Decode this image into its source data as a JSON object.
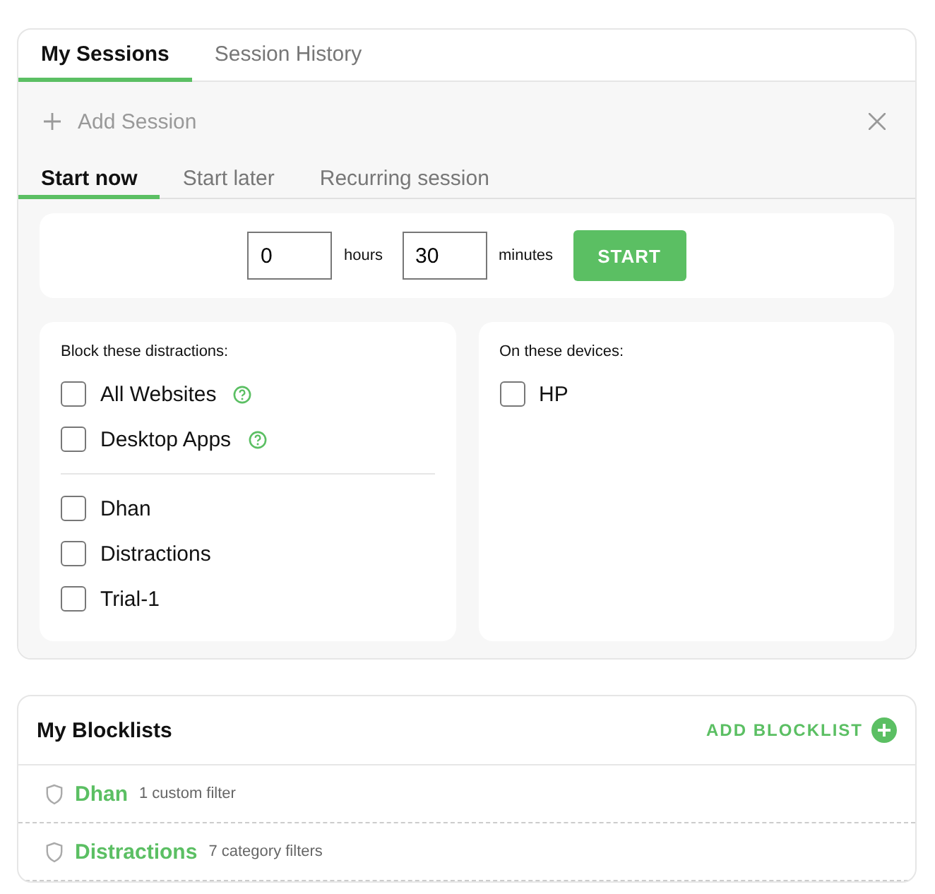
{
  "tabs": [
    {
      "label": "My Sessions",
      "selected": true
    },
    {
      "label": "Session History",
      "selected": false
    }
  ],
  "add_session": {
    "label": "Add Session"
  },
  "start_tabs": [
    {
      "label": "Start now",
      "selected": true
    },
    {
      "label": "Start later",
      "selected": false
    },
    {
      "label": "Recurring session",
      "selected": false
    }
  ],
  "timer": {
    "hours_value": "0",
    "hours_label": "hours",
    "minutes_value": "30",
    "minutes_label": "minutes",
    "button": "START"
  },
  "distractions": {
    "title": "Block these distractions:",
    "general": [
      {
        "label": "All Websites",
        "checked": false,
        "help": true
      },
      {
        "label": "Desktop Apps",
        "checked": false,
        "help": true
      }
    ],
    "blocklists": [
      {
        "label": "Dhan",
        "checked": false
      },
      {
        "label": "Distractions",
        "checked": false
      },
      {
        "label": "Trial-1",
        "checked": false
      }
    ]
  },
  "devices": {
    "title": "On these devices:",
    "items": [
      {
        "label": "HP",
        "checked": false
      }
    ]
  },
  "my_blocklists": {
    "title": "My Blocklists",
    "add_button": "ADD BLOCKLIST",
    "items": [
      {
        "name": "Dhan",
        "detail": "1 custom filter"
      },
      {
        "name": "Distractions",
        "detail": "7 category filters"
      }
    ]
  }
}
